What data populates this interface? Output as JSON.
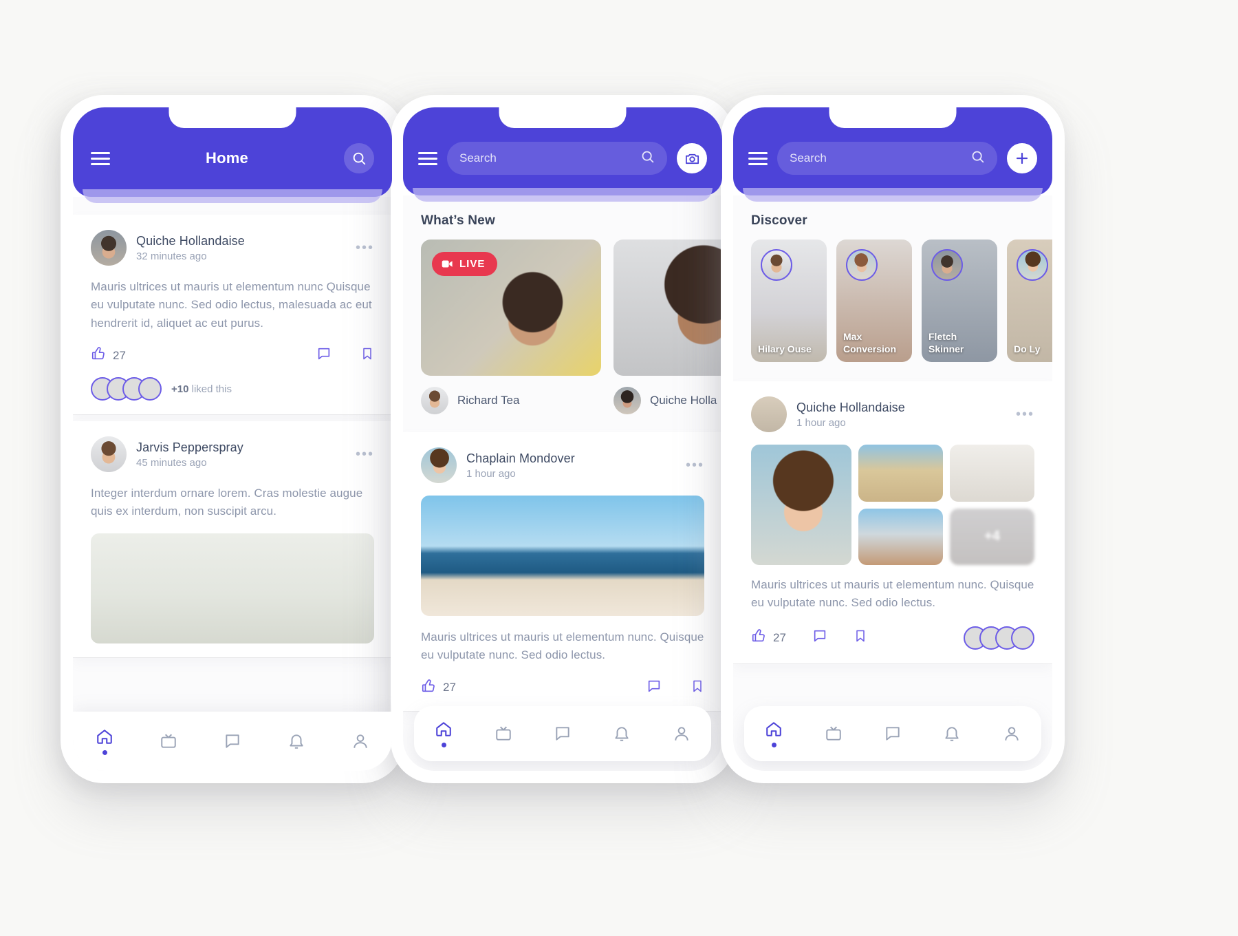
{
  "phones": [
    {
      "id": "phone-home",
      "header": {
        "type": "title",
        "title": "Home",
        "menu_icon": "hamburger-icon",
        "action_icon": "search-icon"
      },
      "posts": [
        {
          "author": "Quiche Hollandaise",
          "time": "32 minutes ago",
          "text": "Mauris ultrices ut mauris ut elementum nunc Quisque eu vulputate nunc. Sed odio lectus, malesuada ac eut hendrerit id, aliquet ac eut purus.",
          "likes": "27",
          "liked_count": "+10",
          "liked_suffix": "liked this",
          "more_icon": "more-options-icon",
          "like_icon": "thumbs-up-icon",
          "comment_icon": "comment-icon",
          "bookmark_icon": "bookmark-icon"
        },
        {
          "author": "Jarvis Pepperspray",
          "time": "45 minutes ago",
          "text": "Integer interdum ornare lorem. Cras molestie augue quis ex interdum, non suscipit arcu.",
          "more_icon": "more-options-icon"
        }
      ],
      "nav": [
        {
          "icon": "home-icon",
          "active": true
        },
        {
          "icon": "tv-icon",
          "active": false
        },
        {
          "icon": "chat-icon",
          "active": false
        },
        {
          "icon": "bell-icon",
          "active": false
        },
        {
          "icon": "person-icon",
          "active": false
        }
      ]
    },
    {
      "id": "phone-search",
      "header": {
        "type": "search",
        "placeholder": "Search",
        "menu_icon": "hamburger-icon",
        "search_icon": "search-icon",
        "action_icon": "camera-icon"
      },
      "whats_new": {
        "title": "What’s New",
        "items": [
          {
            "author": "Richard Tea",
            "live": true,
            "live_label": "LIVE",
            "live_icon": "video-camera-icon"
          },
          {
            "author": "Quiche Holla",
            "live": false
          }
        ]
      },
      "post": {
        "author": "Chaplain Mondover",
        "time": "1 hour ago",
        "text": "Mauris ultrices ut mauris ut elementum nunc. Quisque eu vulputate nunc. Sed odio lectus.",
        "likes": "27",
        "more_icon": "more-options-icon",
        "like_icon": "thumbs-up-icon",
        "comment_icon": "comment-icon",
        "bookmark_icon": "bookmark-icon"
      },
      "nav": [
        {
          "icon": "home-icon",
          "active": true
        },
        {
          "icon": "tv-icon",
          "active": false
        },
        {
          "icon": "chat-icon",
          "active": false
        },
        {
          "icon": "bell-icon",
          "active": false
        },
        {
          "icon": "person-icon",
          "active": false
        }
      ]
    },
    {
      "id": "phone-discover",
      "header": {
        "type": "search",
        "placeholder": "Search",
        "menu_icon": "hamburger-icon",
        "search_icon": "search-icon",
        "action_icon": "plus-icon"
      },
      "discover": {
        "title": "Discover",
        "people": [
          {
            "name": "Hilary Ouse"
          },
          {
            "name": "Max Conversion"
          },
          {
            "name": "Fletch Skinner"
          },
          {
            "name": "Do Ly"
          }
        ]
      },
      "post": {
        "author": "Quiche Hollandaise",
        "time": "1 hour ago",
        "text": "Mauris ultrices ut mauris ut elementum nunc. Quisque eu vulputate nunc. Sed odio lectus.",
        "likes": "27",
        "gallery_more": "+4",
        "more_icon": "more-options-icon",
        "like_icon": "thumbs-up-icon",
        "comment_icon": "comment-icon",
        "bookmark_icon": "bookmark-icon"
      },
      "nav": [
        {
          "icon": "home-icon",
          "active": true
        },
        {
          "icon": "tv-icon",
          "active": false
        },
        {
          "icon": "chat-icon",
          "active": false
        },
        {
          "icon": "bell-icon",
          "active": false
        },
        {
          "icon": "person-icon",
          "active": false
        }
      ]
    }
  ],
  "colors": {
    "brand": "#4d43d8",
    "brand_light": "#b9b3f2",
    "live_red": "#e8384f",
    "text_dark": "#3e4a63",
    "text_muted": "#9aa3b6",
    "background": "#f7f7f5"
  }
}
